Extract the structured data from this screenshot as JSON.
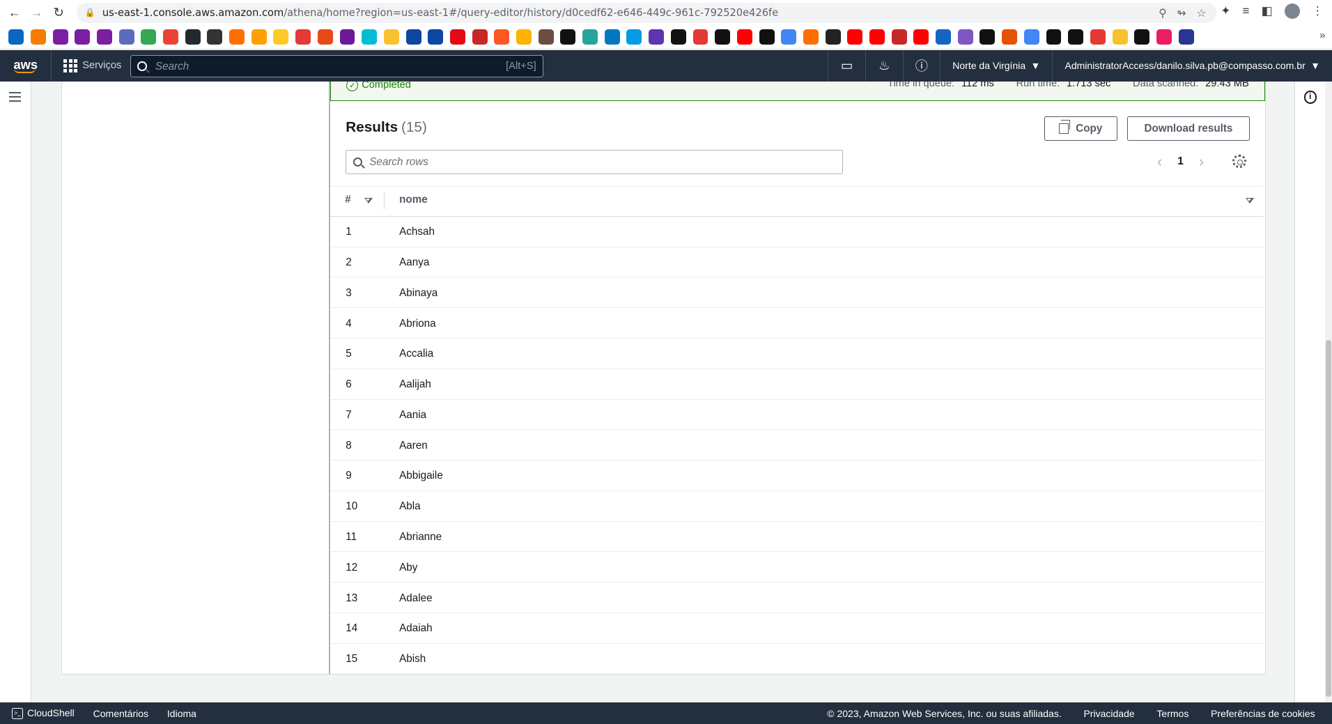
{
  "browser": {
    "url_host": "us-east-1.console.aws.amazon.com",
    "url_path": "/athena/home?region=us-east-1#/query-editor/history/d0cedf62-e646-449c-961c-792520e426fe"
  },
  "bookmark_colors": [
    "#0a66c2",
    "#f57c00",
    "#7b1fa2",
    "#7b1fa2",
    "#7b1fa2",
    "#5c6bc0",
    "#34a853",
    "#ea4335",
    "#24292f",
    "#333",
    "#ff6f00",
    "#ffa000",
    "#ffca28",
    "#e53935",
    "#e64a19",
    "#6a1b9a",
    "#00bcd4",
    "#fbc02d",
    "#0d47a1",
    "#0d47a1",
    "#e50914",
    "#c62828",
    "#ff5722",
    "#ffb300",
    "#6d4c41",
    "#111",
    "#26a69a",
    "#0277bd",
    "#039be5",
    "#5e35b1",
    "#111",
    "#e53935",
    "#111",
    "#ff0000",
    "#111",
    "#4285f4",
    "#ff6f00",
    "#222",
    "#ff0000",
    "#ff0000",
    "#c62828",
    "#ff0000",
    "#1565c0",
    "#7e57c2",
    "#111",
    "#e65100",
    "#4285f4",
    "#111",
    "#111",
    "#e53935",
    "#fbc02d",
    "#111",
    "#e91e63",
    "#283593"
  ],
  "aws": {
    "logo": "aws",
    "services": "Serviços",
    "search_placeholder": "Search",
    "search_shortcut": "[Alt+S]",
    "region": "Norte da Virgínia",
    "account": "AdministratorAccess/danilo.silva.pb@compasso.com.br"
  },
  "status": {
    "state": "Completed",
    "time_in_queue_label": "Time in queue:",
    "time_in_queue": "112 ms",
    "run_time_label": "Run time:",
    "run_time": "1.713 sec",
    "data_scanned_label": "Data scanned:",
    "data_scanned": "29.43 MB"
  },
  "results": {
    "title": "Results",
    "count": "(15)",
    "copy_label": "Copy",
    "download_label": "Download results",
    "search_placeholder": "Search rows",
    "page": "1",
    "col_index": "#",
    "col_nome": "nome",
    "rows": [
      {
        "n": "1",
        "nome": "Achsah"
      },
      {
        "n": "2",
        "nome": "Aanya"
      },
      {
        "n": "3",
        "nome": "Abinaya"
      },
      {
        "n": "4",
        "nome": "Abriona"
      },
      {
        "n": "5",
        "nome": "Accalia"
      },
      {
        "n": "6",
        "nome": "Aalijah"
      },
      {
        "n": "7",
        "nome": "Aania"
      },
      {
        "n": "8",
        "nome": "Aaren"
      },
      {
        "n": "9",
        "nome": "Abbigaile"
      },
      {
        "n": "10",
        "nome": "Abla"
      },
      {
        "n": "11",
        "nome": "Abrianne"
      },
      {
        "n": "12",
        "nome": "Aby"
      },
      {
        "n": "13",
        "nome": "Adalee"
      },
      {
        "n": "14",
        "nome": "Adaiah"
      },
      {
        "n": "15",
        "nome": "Abish"
      }
    ]
  },
  "footer": {
    "cloudshell": "CloudShell",
    "feedback": "Comentários",
    "language": "Idioma",
    "copyright": "© 2023, Amazon Web Services, Inc. ou suas afiliadas.",
    "privacy": "Privacidade",
    "terms": "Termos",
    "cookies": "Preferências de cookies"
  }
}
